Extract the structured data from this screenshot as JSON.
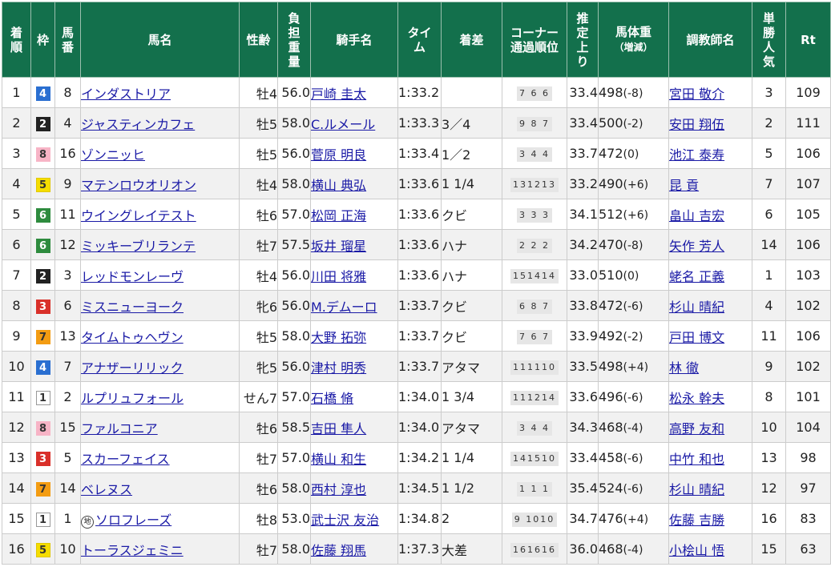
{
  "headers": [
    {
      "key": "rank",
      "label": "着\n順"
    },
    {
      "key": "waku",
      "label": "枠"
    },
    {
      "key": "umaban",
      "label": "馬\n番"
    },
    {
      "key": "name",
      "label": "馬名"
    },
    {
      "key": "sexage",
      "label": "性齢"
    },
    {
      "key": "weight",
      "label": "負\n担\n重\n量"
    },
    {
      "key": "jockey",
      "label": "騎手名"
    },
    {
      "key": "time",
      "label": "タイ\nム"
    },
    {
      "key": "margin",
      "label": "着差"
    },
    {
      "key": "corner",
      "label": "コーナー\n通過順位"
    },
    {
      "key": "last3f",
      "label": "推\n定\n上\nり"
    },
    {
      "key": "body",
      "label": "馬体重",
      "sub": "（増減）"
    },
    {
      "key": "trainer",
      "label": "調教師名"
    },
    {
      "key": "pop",
      "label": "単\n勝\n人\n気"
    },
    {
      "key": "rt",
      "label": "Rt"
    }
  ],
  "waku_colors": {
    "1": {
      "bg": "#ffffff",
      "fg": "#333333",
      "border": "#999999"
    },
    "2": {
      "bg": "#222222",
      "fg": "#ffffff",
      "border": "#222222"
    },
    "3": {
      "bg": "#d9302a",
      "fg": "#ffffff",
      "border": "#d9302a"
    },
    "4": {
      "bg": "#2a6fd1",
      "fg": "#ffffff",
      "border": "#2a6fd1"
    },
    "5": {
      "bg": "#f5dd00",
      "fg": "#333333",
      "border": "#e0c800"
    },
    "6": {
      "bg": "#2e8b3e",
      "fg": "#ffffff",
      "border": "#2e8b3e"
    },
    "7": {
      "bg": "#f39c12",
      "fg": "#333333",
      "border": "#f39c12"
    },
    "8": {
      "bg": "#f7b4c6",
      "fg": "#333333",
      "border": "#f7b4c6"
    }
  },
  "rows": [
    {
      "rank": "1",
      "waku": "4",
      "umaban": "8",
      "name": "インダストリア",
      "mark": "",
      "sexage": "牡4",
      "weight": "56.0",
      "jockey": "戸崎 圭太",
      "time": "1:33.2",
      "margin": "",
      "corner": "7 6 6",
      "last3f": "33.4",
      "body": "498",
      "diff": "(-8)",
      "trainer": "宮田 敬介",
      "pop": "3",
      "rt": "109"
    },
    {
      "rank": "2",
      "waku": "2",
      "umaban": "4",
      "name": "ジャスティンカフェ",
      "mark": "",
      "sexage": "牡5",
      "weight": "58.0",
      "jockey": "C.ルメール",
      "time": "1:33.3",
      "margin": "3／4",
      "corner": "9 8 7",
      "last3f": "33.4",
      "body": "500",
      "diff": "(-2)",
      "trainer": "安田 翔伍",
      "pop": "2",
      "rt": "111"
    },
    {
      "rank": "3",
      "waku": "8",
      "umaban": "16",
      "name": "ゾンニッヒ",
      "mark": "",
      "sexage": "牡5",
      "weight": "56.0",
      "jockey": "菅原 明良",
      "time": "1:33.4",
      "margin": "1／2",
      "corner": "3 4 4",
      "last3f": "33.7",
      "body": "472",
      "diff": "(0)",
      "trainer": "池江 泰寿",
      "pop": "5",
      "rt": "106"
    },
    {
      "rank": "4",
      "waku": "5",
      "umaban": "9",
      "name": "マテンロウオリオン",
      "mark": "",
      "sexage": "牡4",
      "weight": "58.0",
      "jockey": "横山 典弘",
      "time": "1:33.6",
      "margin": "1 1/4",
      "corner": "131213",
      "last3f": "33.2",
      "body": "490",
      "diff": "(+6)",
      "trainer": "昆 貢",
      "pop": "7",
      "rt": "107"
    },
    {
      "rank": "5",
      "waku": "6",
      "umaban": "11",
      "name": "ウイングレイテスト",
      "mark": "",
      "sexage": "牡6",
      "weight": "57.0",
      "jockey": "松岡 正海",
      "time": "1:33.6",
      "margin": "クビ",
      "corner": "3 3 3",
      "last3f": "34.1",
      "body": "512",
      "diff": "(+6)",
      "trainer": "畠山 吉宏",
      "pop": "6",
      "rt": "105"
    },
    {
      "rank": "6",
      "waku": "6",
      "umaban": "12",
      "name": "ミッキーブリランテ",
      "mark": "",
      "sexage": "牡7",
      "weight": "57.5",
      "jockey": "坂井 瑠星",
      "time": "1:33.6",
      "margin": "ハナ",
      "corner": "2 2 2",
      "last3f": "34.2",
      "body": "470",
      "diff": "(-8)",
      "trainer": "矢作 芳人",
      "pop": "14",
      "rt": "106"
    },
    {
      "rank": "7",
      "waku": "2",
      "umaban": "3",
      "name": "レッドモンレーヴ",
      "mark": "",
      "sexage": "牡4",
      "weight": "56.0",
      "jockey": "川田 将雅",
      "time": "1:33.6",
      "margin": "ハナ",
      "corner": "151414",
      "last3f": "33.0",
      "body": "510",
      "diff": "(0)",
      "trainer": "蛯名 正義",
      "pop": "1",
      "rt": "103"
    },
    {
      "rank": "8",
      "waku": "3",
      "umaban": "6",
      "name": "ミスニューヨーク",
      "mark": "",
      "sexage": "牝6",
      "weight": "56.0",
      "jockey": "M.デムーロ",
      "time": "1:33.7",
      "margin": "クビ",
      "corner": "6 8 7",
      "last3f": "33.8",
      "body": "472",
      "diff": "(-6)",
      "trainer": "杉山 晴紀",
      "pop": "4",
      "rt": "102"
    },
    {
      "rank": "9",
      "waku": "7",
      "umaban": "13",
      "name": "タイムトゥヘヴン",
      "mark": "",
      "sexage": "牡5",
      "weight": "58.0",
      "jockey": "大野 拓弥",
      "time": "1:33.7",
      "margin": "クビ",
      "corner": "7 6 7",
      "last3f": "33.9",
      "body": "492",
      "diff": "(-2)",
      "trainer": "戸田 博文",
      "pop": "11",
      "rt": "106"
    },
    {
      "rank": "10",
      "waku": "4",
      "umaban": "7",
      "name": "アナザーリリック",
      "mark": "",
      "sexage": "牝5",
      "weight": "56.0",
      "jockey": "津村 明秀",
      "time": "1:33.7",
      "margin": "アタマ",
      "corner": "111110",
      "last3f": "33.5",
      "body": "498",
      "diff": "(+4)",
      "trainer": "林 徹",
      "pop": "9",
      "rt": "102"
    },
    {
      "rank": "11",
      "waku": "1",
      "umaban": "2",
      "name": "ルプリュフォール",
      "mark": "",
      "sexage": "せん7",
      "weight": "57.0",
      "jockey": "石橋 脩",
      "time": "1:34.0",
      "margin": "1 3/4",
      "corner": "111214",
      "last3f": "33.6",
      "body": "496",
      "diff": "(-6)",
      "trainer": "松永 幹夫",
      "pop": "8",
      "rt": "101"
    },
    {
      "rank": "12",
      "waku": "8",
      "umaban": "15",
      "name": "ファルコニア",
      "mark": "",
      "sexage": "牡6",
      "weight": "58.5",
      "jockey": "吉田 隼人",
      "time": "1:34.0",
      "margin": "アタマ",
      "corner": "3 4 4",
      "last3f": "34.3",
      "body": "468",
      "diff": "(-4)",
      "trainer": "高野 友和",
      "pop": "10",
      "rt": "104"
    },
    {
      "rank": "13",
      "waku": "3",
      "umaban": "5",
      "name": "スカーフェイス",
      "mark": "",
      "sexage": "牡7",
      "weight": "57.0",
      "jockey": "横山 和生",
      "time": "1:34.2",
      "margin": "1 1/4",
      "corner": "141510",
      "last3f": "33.4",
      "body": "458",
      "diff": "(-6)",
      "trainer": "中竹 和也",
      "pop": "13",
      "rt": "98"
    },
    {
      "rank": "14",
      "waku": "7",
      "umaban": "14",
      "name": "ベレヌス",
      "mark": "",
      "sexage": "牡6",
      "weight": "58.0",
      "jockey": "西村 淳也",
      "time": "1:34.5",
      "margin": "1 1/2",
      "corner": "1 1 1",
      "last3f": "35.4",
      "body": "524",
      "diff": "(-6)",
      "trainer": "杉山 晴紀",
      "pop": "12",
      "rt": "97"
    },
    {
      "rank": "15",
      "waku": "1",
      "umaban": "1",
      "name": "ソロフレーズ",
      "mark": "地",
      "sexage": "牡8",
      "weight": "53.0",
      "jockey": "武士沢 友治",
      "time": "1:34.8",
      "margin": "2",
      "corner": "9 1010",
      "last3f": "34.7",
      "body": "476",
      "diff": "(+4)",
      "trainer": "佐藤 吉勝",
      "pop": "16",
      "rt": "83"
    },
    {
      "rank": "16",
      "waku": "5",
      "umaban": "10",
      "name": "トーラスジェミニ",
      "mark": "",
      "sexage": "牡7",
      "weight": "58.0",
      "jockey": "佐藤 翔馬",
      "time": "1:37.3",
      "margin": "大差",
      "corner": "161616",
      "last3f": "36.0",
      "body": "468",
      "diff": "(-4)",
      "trainer": "小桧山 悟",
      "pop": "15",
      "rt": "63"
    }
  ]
}
